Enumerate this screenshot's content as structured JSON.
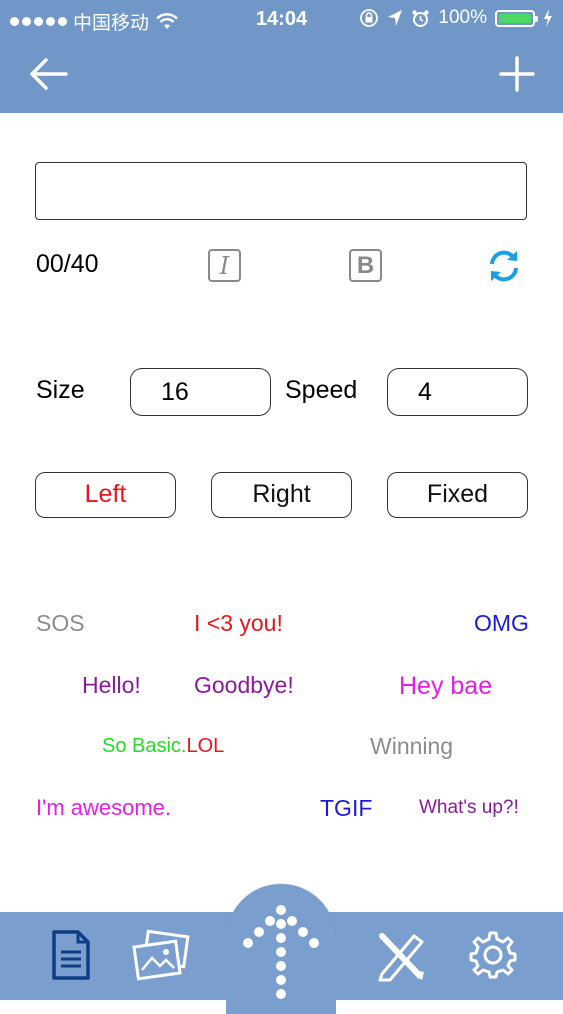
{
  "status_bar": {
    "carrier": "中国移动",
    "time": "14:04",
    "battery": "100%",
    "battery_level": 1.0,
    "icons": [
      "signal-dots-icon",
      "wifi-icon",
      "lock-rotation-icon",
      "location-icon",
      "alarm-icon",
      "battery-icon",
      "charging-icon"
    ]
  },
  "nav": {
    "back_icon": "arrow-left-icon",
    "add_icon": "plus-icon"
  },
  "editor": {
    "text_value": "",
    "counter": "00/40",
    "italic_label": "I",
    "bold_label": "B",
    "refresh_icon": "refresh-icon"
  },
  "settings": {
    "size_label": "Size",
    "size_value": "16",
    "speed_label": "Speed",
    "speed_value": "4"
  },
  "direction": {
    "left": "Left",
    "right": "Right",
    "fixed": "Fixed",
    "selected": "Left"
  },
  "presets": [
    {
      "text": "SOS",
      "color": "#8c8c8c"
    },
    {
      "text": "I <3 you!",
      "color": "#e8161c"
    },
    {
      "text": "OMG",
      "color": "#1c1cd8"
    },
    {
      "text": "Hello!",
      "color": "#8b1a9c"
    },
    {
      "text": "Goodbye!",
      "color": "#8b1a9c"
    },
    {
      "text": "Hey bae",
      "color": "#e61ee6"
    },
    {
      "text": "So Basic.",
      "color": "#22dd22"
    },
    {
      "text": "LOL",
      "color": "#e8161c"
    },
    {
      "text": "Winning",
      "color": "#8c8c8c"
    },
    {
      "text": "I'm awesome.",
      "color": "#e61ee6"
    },
    {
      "text": "TGIF",
      "color": "#1c1cd8"
    },
    {
      "text": "What's up?!",
      "color": "#8b1a9c"
    }
  ],
  "tabbar": {
    "tabs": [
      "document-icon",
      "gallery-icon",
      "send-icon",
      "draw-icon",
      "settings-gear-icon"
    ]
  },
  "colors": {
    "bar": "#7197c9",
    "tabbar": "#7a9fce",
    "accent": "#1a9ee8",
    "selected": "#e8161c"
  }
}
